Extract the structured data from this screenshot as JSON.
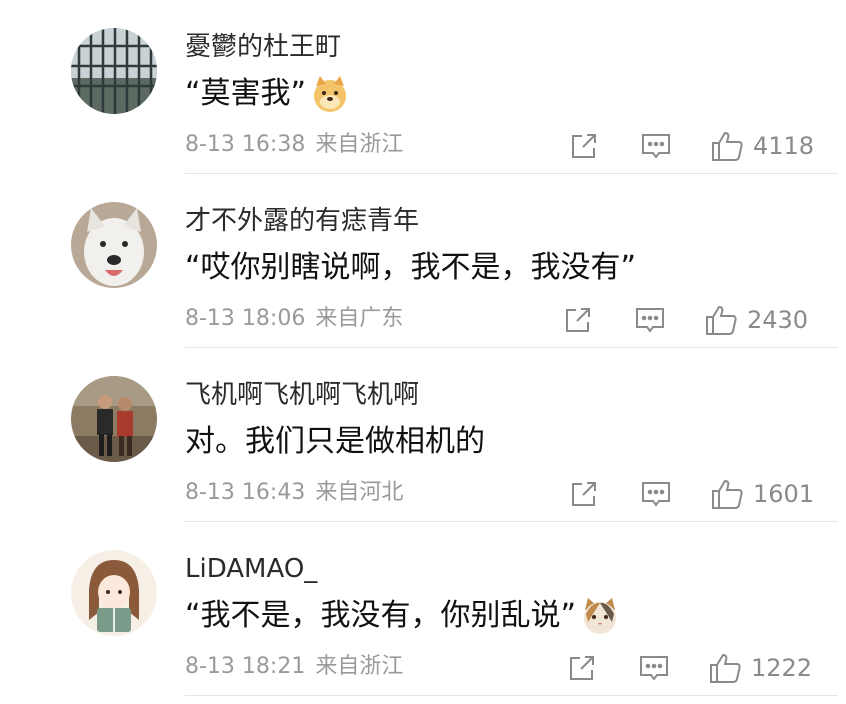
{
  "comments": [
    {
      "username": "憂鬱的杜王町",
      "text": "“莫害我”",
      "emoji": "doge-emoji",
      "date_time": "8-13 16:38",
      "location": "来自浙江",
      "likes": "4118"
    },
    {
      "username": "才不外露的有痣青年",
      "text": "“哎你别瞎说啊，我不是，我没有”",
      "emoji": "",
      "date_time": "8-13 18:06",
      "location": "来自广东",
      "likes": "2430"
    },
    {
      "username": "飞机啊飞机啊飞机啊",
      "text": "对。我们只是做相机的",
      "emoji": "",
      "date_time": "8-13 16:43",
      "location": "来自河北",
      "likes": "1601"
    },
    {
      "username": "LiDAMAO_",
      "text": "“我不是，我没有，你别乱说”",
      "emoji": "cat-emoji",
      "date_time": "8-13 18:21",
      "location": "来自浙江",
      "likes": "1222"
    }
  ],
  "icons": {
    "share": "share-icon",
    "comment": "comment-icon",
    "like": "thumbs-up-icon"
  },
  "colors": {
    "username": "#2b2b2b",
    "text": "#111111",
    "meta": "#9a9a9a",
    "icon": "#8a8a8a",
    "divider": "#e6e6e6"
  }
}
